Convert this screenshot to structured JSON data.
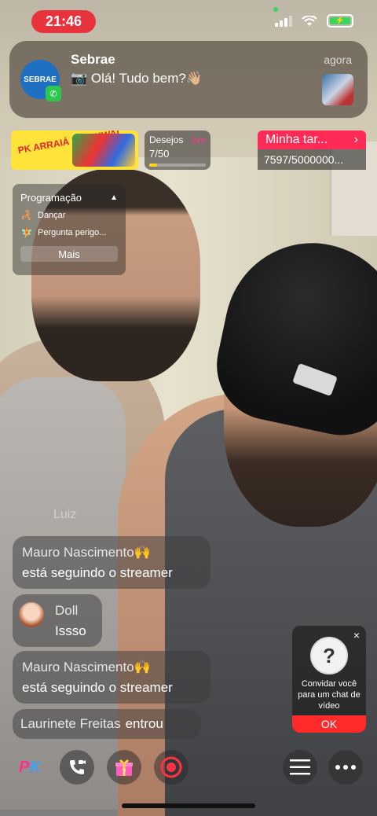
{
  "status_bar": {
    "time": "21:46",
    "signal_icon": "cellular-signal-icon",
    "wifi_icon": "wifi-icon",
    "battery_icon": "battery-charging-icon",
    "colors": {
      "time_pill": "#e8323c",
      "battery": "#37d65c"
    }
  },
  "notification": {
    "app_icon_text": "SEBRAE",
    "badge_icon": "whatsapp-icon",
    "title": "Sebrae",
    "message": "📷 Olá! Tudo bem?👋🏼",
    "time": "agora"
  },
  "event_banner": {
    "text": "PK ARRAIÁ LIVE KWAI"
  },
  "wishes": {
    "label": "Desejos",
    "heart_icon": "heart-live-icon",
    "heart_text": "live",
    "count": "7/50",
    "progress": 0.14
  },
  "task": {
    "label": "Minha tar...",
    "chevron": "›",
    "value": "7597/5000000..."
  },
  "programacao": {
    "title": "Programação",
    "caret": "▲",
    "items": [
      {
        "icon": "🦂",
        "label": "Dançar"
      },
      {
        "icon": "🧚",
        "label": "Pergunta perigo..."
      }
    ],
    "more_label": "Mais"
  },
  "chat": {
    "faded_name": "Luiz",
    "messages": [
      {
        "name": "Mauro Nascimento🙌",
        "body": "está seguindo o streamer"
      },
      {
        "name": "Doll",
        "body": "Issso"
      },
      {
        "name": "Mauro Nascimento🙌",
        "body": "está seguindo o streamer"
      },
      {
        "name": "Laurinete Freitas",
        "body": "entrou"
      }
    ]
  },
  "guest_invite": {
    "close": "×",
    "avatar_text": "?",
    "text": "Convidar você para um chat de vídeo",
    "ok_label": "OK"
  },
  "toolbar": {
    "pk_p": "P",
    "pk_k": "K",
    "call_icon": "video-call-icon",
    "gift_icon": "gift-icon",
    "record_icon": "record-icon",
    "menu_icon": "menu-icon",
    "more_icon": "more-icon"
  }
}
